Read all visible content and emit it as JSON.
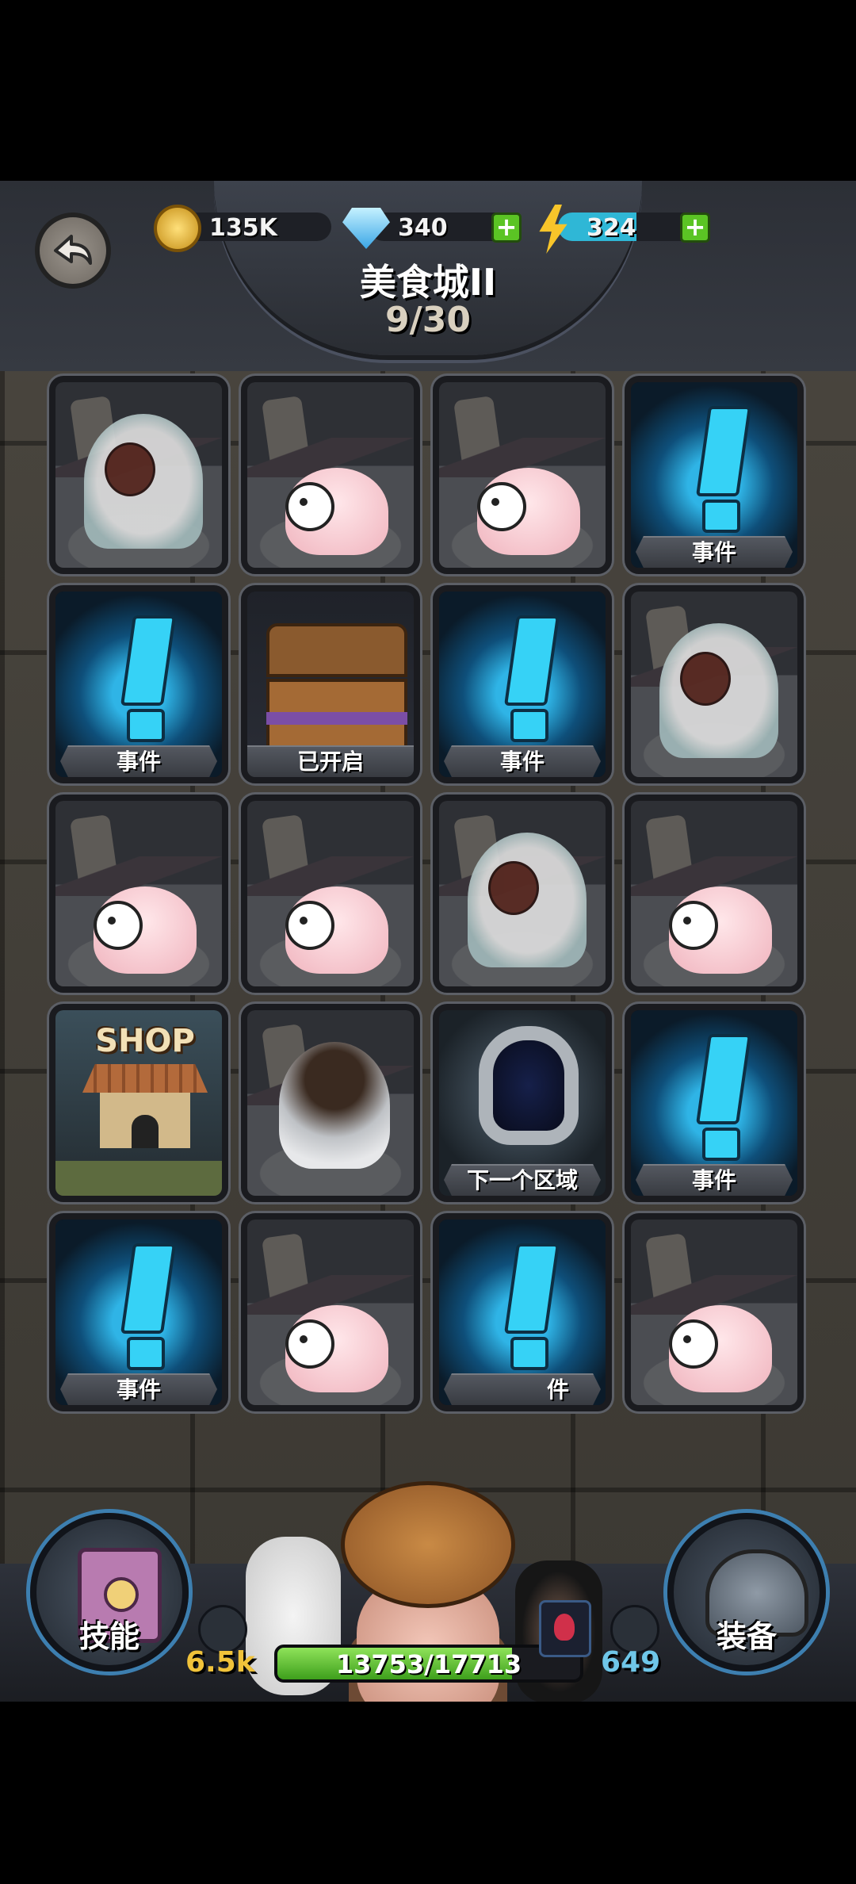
{
  "top": {
    "gold": "135K",
    "gems": "340",
    "energy": "324",
    "title": "美食城II",
    "progress": "9/30"
  },
  "grid": {
    "cards": [
      {
        "type": "ghost",
        "label": ""
      },
      {
        "type": "blob",
        "label": ""
      },
      {
        "type": "blob",
        "label": ""
      },
      {
        "type": "event",
        "label": "事件"
      },
      {
        "type": "event",
        "label": "事件"
      },
      {
        "type": "chest",
        "label": "已开启"
      },
      {
        "type": "event",
        "label": "事件"
      },
      {
        "type": "ghost",
        "label": ""
      },
      {
        "type": "blob",
        "label": ""
      },
      {
        "type": "blob",
        "label": ""
      },
      {
        "type": "ghost",
        "label": ""
      },
      {
        "type": "blob",
        "label": ""
      },
      {
        "type": "shop",
        "label": ""
      },
      {
        "type": "pumpkin-ghost",
        "label": ""
      },
      {
        "type": "portal",
        "label": "下一个区域"
      },
      {
        "type": "event",
        "label": "事件"
      },
      {
        "type": "event",
        "label": "事件"
      },
      {
        "type": "blob",
        "label": ""
      },
      {
        "type": "event",
        "label": "件"
      },
      {
        "type": "blob",
        "label": ""
      }
    ],
    "shop_sign": "SHOP"
  },
  "hud": {
    "skills_label": "技能",
    "equip_label": "装备",
    "attack": "6.5k",
    "hp_text": "13753/17713",
    "hp_fraction": 0.776,
    "defense": "649"
  },
  "colors": {
    "accent_green": "#5bc424",
    "event_blue": "#36d2f6",
    "hp_green": "#6cc93a"
  },
  "icons": [
    "back-arrow-icon",
    "gold-coin-icon",
    "diamond-icon",
    "lightning-icon",
    "plus-icon",
    "sword-icon",
    "shield-icon",
    "potion-icon",
    "spellbook-icon",
    "helmet-icon"
  ]
}
